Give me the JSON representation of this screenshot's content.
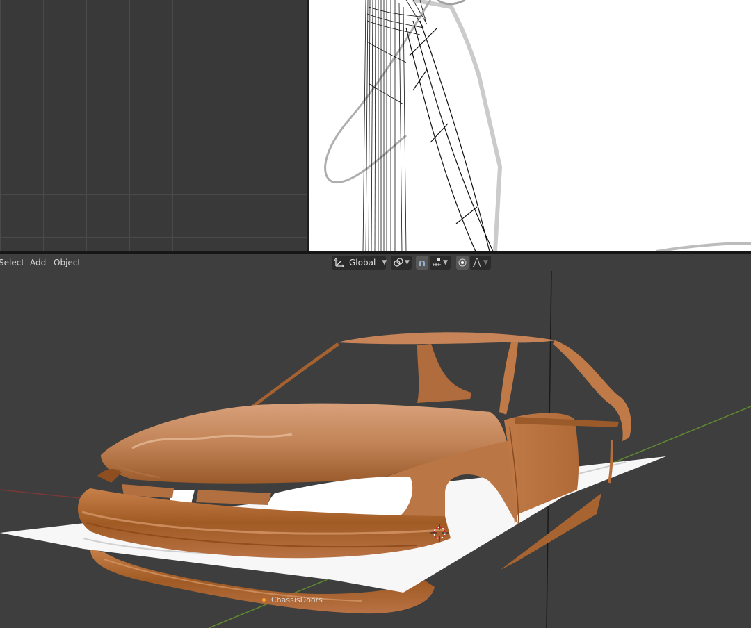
{
  "header_menu": {
    "select": "Select",
    "add": "Add",
    "object": "Object"
  },
  "transform": {
    "orientation": "Global"
  },
  "icons": {
    "orientation": "transform-orientation-icon",
    "pivot": "pivot-point-icon",
    "snap": "snap-magnet-icon",
    "snap_target": "snap-increment-icon",
    "proportional": "proportional-editing-icon",
    "falloff": "falloff-curve-icon",
    "cursor": "3d-cursor-icon"
  },
  "scene": {
    "object_label": "ChassisDoors",
    "car_color": "#c07a48",
    "axis_x_color": "#8a3a3a",
    "axis_y_color": "#5f8a30"
  }
}
